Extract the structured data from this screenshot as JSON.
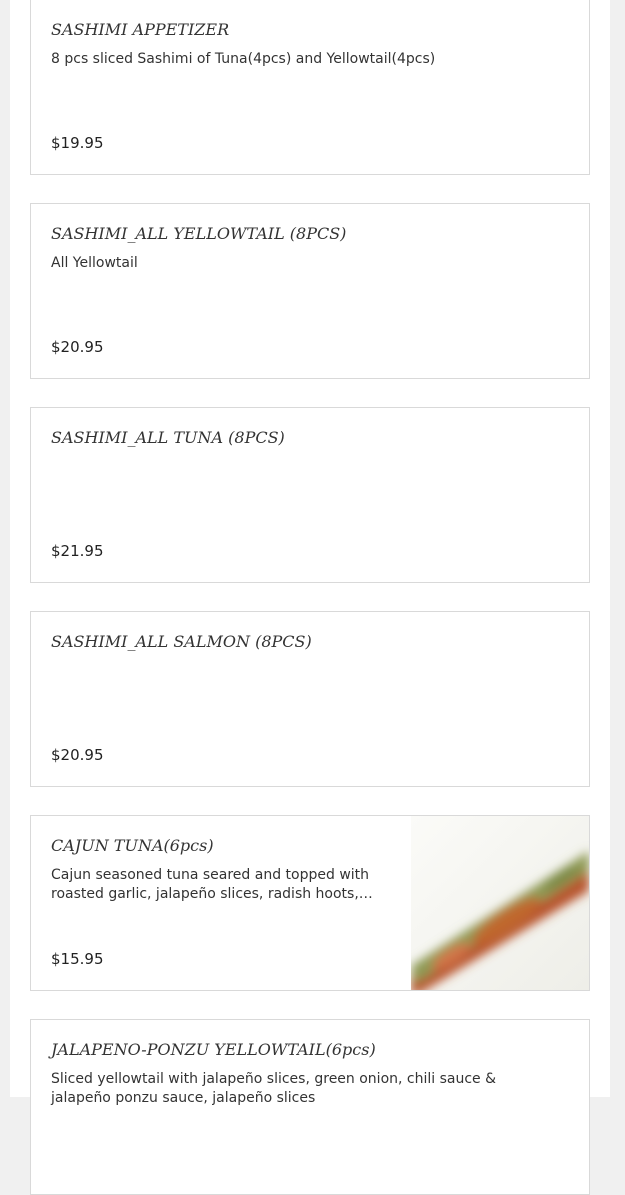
{
  "menu_items": [
    {
      "title": "SASHIMI APPETIZER",
      "description": "8 pcs sliced Sashimi of Tuna(4pcs) and Yellowtail(4pcs)",
      "price": "$19.95"
    },
    {
      "title": "SASHIMI_ALL YELLOWTAIL (8PCS)",
      "description": "All Yellowtail",
      "price": "$20.95"
    },
    {
      "title": "SASHIMI_ALL TUNA (8PCS)",
      "description": "",
      "price": "$21.95"
    },
    {
      "title": "SASHIMI_ALL SALMON (8PCS)",
      "description": "",
      "price": "$20.95"
    },
    {
      "title": "CAJUN TUNA(6pcs)",
      "description": "Cajun seasoned tuna seared and topped with roasted garlic, jalapeño slices, radish hoots, yuzu...",
      "price": "$15.95"
    },
    {
      "title": "JALAPENO-PONZU YELLOWTAIL(6pcs)",
      "description": "Sliced yellowtail with jalapeño slices, green onion, chili sauce & jalapeño ponzu sauce, jalapeño slices",
      "price": ""
    }
  ],
  "colors": {
    "page_background": "#f0f0f0",
    "card_border": "#d9d9d9",
    "text": "#333333"
  }
}
